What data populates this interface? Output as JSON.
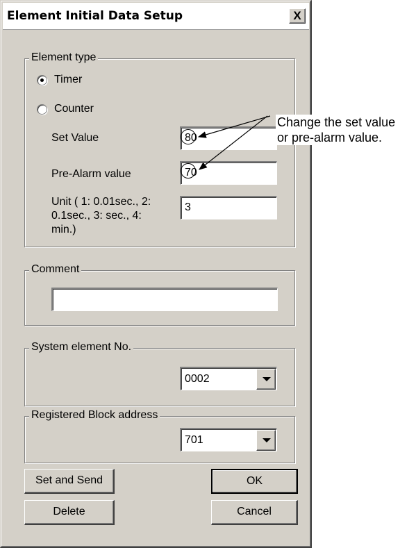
{
  "window": {
    "title": "Element Initial Data Setup",
    "close_glyph": "X"
  },
  "element_type": {
    "legend": "Element type",
    "radio_timer": "Timer",
    "radio_counter": "Counter",
    "selected": "Timer",
    "set_value_label": "Set Value",
    "set_value": "80",
    "pre_alarm_label": "Pre-Alarm value",
    "pre_alarm_value": "70",
    "unit_label_line1": "Unit ( 1: 0.01sec., 2:",
    "unit_label_line2": "0.1sec., 3: sec., 4:",
    "unit_label_line3": "min.)",
    "unit_value": "3"
  },
  "comment": {
    "legend": "Comment",
    "value": ""
  },
  "system_element": {
    "legend": "System element No.",
    "selected": "0002"
  },
  "block_address": {
    "legend": "Registered Block address",
    "selected": "701"
  },
  "buttons": {
    "set_and_send": "Set and Send",
    "ok": "OK",
    "delete": "Delete",
    "cancel": "Cancel"
  },
  "annotation": {
    "line1": "Change the set value",
    "line2": "or pre-alarm value."
  }
}
